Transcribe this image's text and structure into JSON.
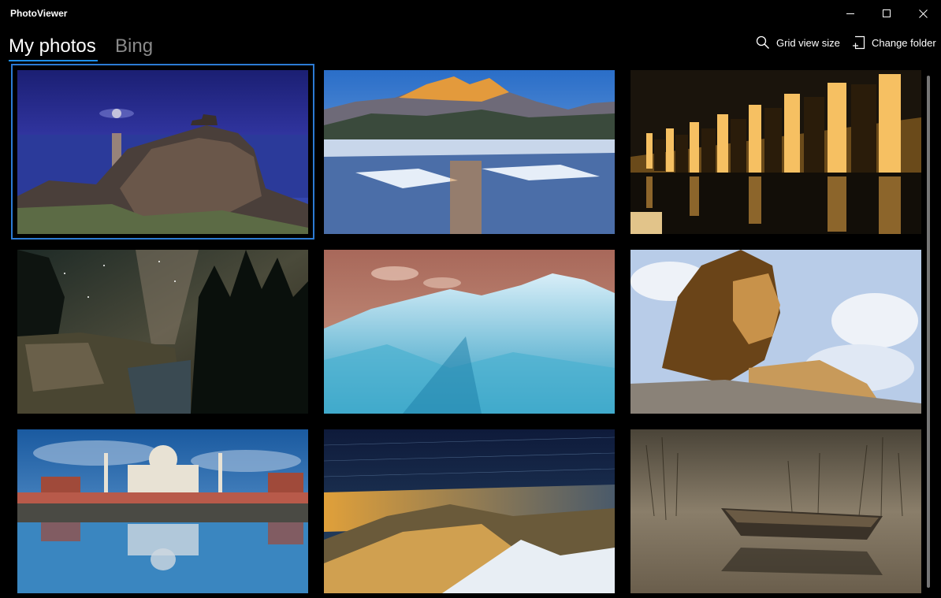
{
  "window": {
    "title": "PhotoViewer"
  },
  "tabs": [
    {
      "label": "My photos",
      "selected": true
    },
    {
      "label": "Bing",
      "selected": false
    }
  ],
  "commands": {
    "grid_view_size": {
      "label": "Grid view size",
      "icon": "search-icon"
    },
    "change_folder": {
      "label": "Change folder",
      "icon": "folder-add-icon"
    }
  },
  "photos": [
    {
      "name": "castle-moonlight",
      "selected": true
    },
    {
      "name": "mountain-lake-sunrise",
      "selected": false
    },
    {
      "name": "mosque-arches-night",
      "selected": false
    },
    {
      "name": "forest-milky-way",
      "selected": false
    },
    {
      "name": "snowy-mountain-dusk",
      "selected": false
    },
    {
      "name": "lion-wind",
      "selected": false
    },
    {
      "name": "taj-mahal-reflection",
      "selected": false
    },
    {
      "name": "star-trails-peak",
      "selected": false
    },
    {
      "name": "boat-reeds-fog",
      "selected": false
    }
  ],
  "colors": {
    "accent": "#1f8fe8",
    "selection_border": "#2c7bd4",
    "background": "#000000"
  }
}
